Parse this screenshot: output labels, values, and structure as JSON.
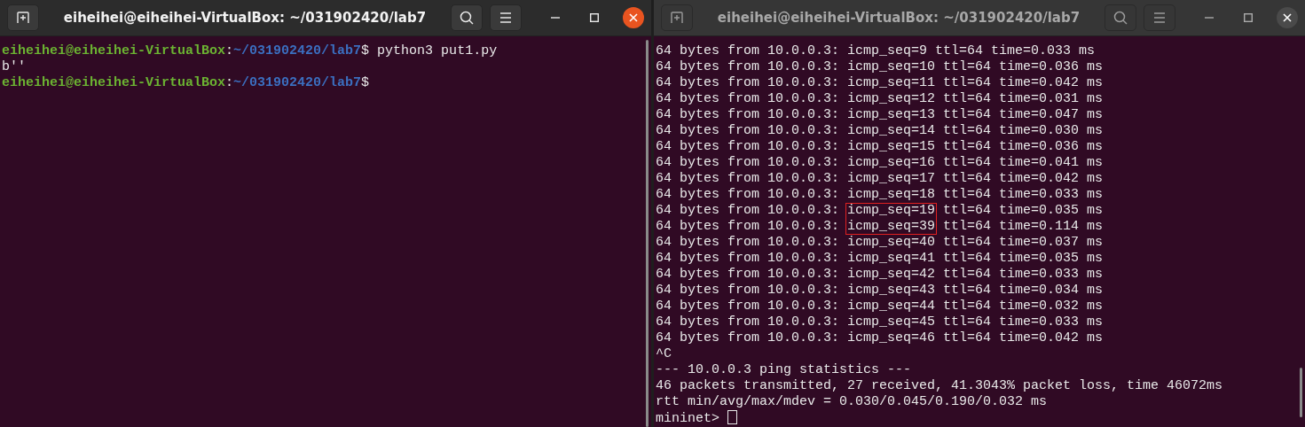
{
  "windows": [
    {
      "title": "eiheihei@eiheihei-VirtualBox: ~/031902420/lab7",
      "active": true,
      "lines": [
        {
          "kind": "prompt",
          "user_host": "eiheihei@eiheihei-VirtualBox",
          "separator": ":",
          "path": "~/031902420/lab7",
          "symbol": "$",
          "command": "python3 put1.py"
        },
        {
          "kind": "output",
          "text": "b''"
        },
        {
          "kind": "prompt",
          "user_host": "eiheihei@eiheihei-VirtualBox",
          "separator": ":",
          "path": "~/031902420/lab7",
          "symbol": "$"
        }
      ]
    },
    {
      "title": "eiheihei@eiheihei-VirtualBox: ~/031902420/lab7",
      "active": false,
      "cursor": true,
      "lines": [
        {
          "kind": "output",
          "text": "64 bytes from 10.0.0.3: icmp_seq=9 ttl=64 time=0.033 ms"
        },
        {
          "kind": "output",
          "text": "64 bytes from 10.0.0.3: icmp_seq=10 ttl=64 time=0.036 ms"
        },
        {
          "kind": "output",
          "text": "64 bytes from 10.0.0.3: icmp_seq=11 ttl=64 time=0.042 ms"
        },
        {
          "kind": "output",
          "text": "64 bytes from 10.0.0.3: icmp_seq=12 ttl=64 time=0.031 ms"
        },
        {
          "kind": "output",
          "text": "64 bytes from 10.0.0.3: icmp_seq=13 ttl=64 time=0.047 ms"
        },
        {
          "kind": "output",
          "text": "64 bytes from 10.0.0.3: icmp_seq=14 ttl=64 time=0.030 ms"
        },
        {
          "kind": "output",
          "text": "64 bytes from 10.0.0.3: icmp_seq=15 ttl=64 time=0.036 ms"
        },
        {
          "kind": "output",
          "text": "64 bytes from 10.0.0.3: icmp_seq=16 ttl=64 time=0.041 ms"
        },
        {
          "kind": "output",
          "text": "64 bytes from 10.0.0.3: icmp_seq=17 ttl=64 time=0.042 ms"
        },
        {
          "kind": "output",
          "text": "64 bytes from 10.0.0.3: icmp_seq=18 ttl=64 time=0.033 ms"
        },
        {
          "kind": "boxed",
          "before": "64 bytes from 10.0.0.3: ",
          "boxed": "icmp_seq=19",
          "after": " ttl=64 time=0.035 ms"
        },
        {
          "kind": "boxed",
          "before": "64 bytes from 10.0.0.3: ",
          "boxed": "icmp_seq=39",
          "after": " ttl=64 time=0.114 ms"
        },
        {
          "kind": "output",
          "text": "64 bytes from 10.0.0.3: icmp_seq=40 ttl=64 time=0.037 ms"
        },
        {
          "kind": "output",
          "text": "64 bytes from 10.0.0.3: icmp_seq=41 ttl=64 time=0.035 ms"
        },
        {
          "kind": "output",
          "text": "64 bytes from 10.0.0.3: icmp_seq=42 ttl=64 time=0.033 ms"
        },
        {
          "kind": "output",
          "text": "64 bytes from 10.0.0.3: icmp_seq=43 ttl=64 time=0.034 ms"
        },
        {
          "kind": "output",
          "text": "64 bytes from 10.0.0.3: icmp_seq=44 ttl=64 time=0.032 ms"
        },
        {
          "kind": "output",
          "text": "64 bytes from 10.0.0.3: icmp_seq=45 ttl=64 time=0.033 ms"
        },
        {
          "kind": "output",
          "text": "64 bytes from 10.0.0.3: icmp_seq=46 ttl=64 time=0.042 ms"
        },
        {
          "kind": "output",
          "text": "^C"
        },
        {
          "kind": "output",
          "text": "--- 10.0.0.3 ping statistics ---"
        },
        {
          "kind": "output",
          "text": "46 packets transmitted, 27 received, 41.3043% packet loss, time 46072ms"
        },
        {
          "kind": "output",
          "text": "rtt min/avg/max/mdev = 0.030/0.045/0.190/0.032 ms"
        },
        {
          "kind": "output",
          "text": "mininet>"
        }
      ]
    }
  ]
}
